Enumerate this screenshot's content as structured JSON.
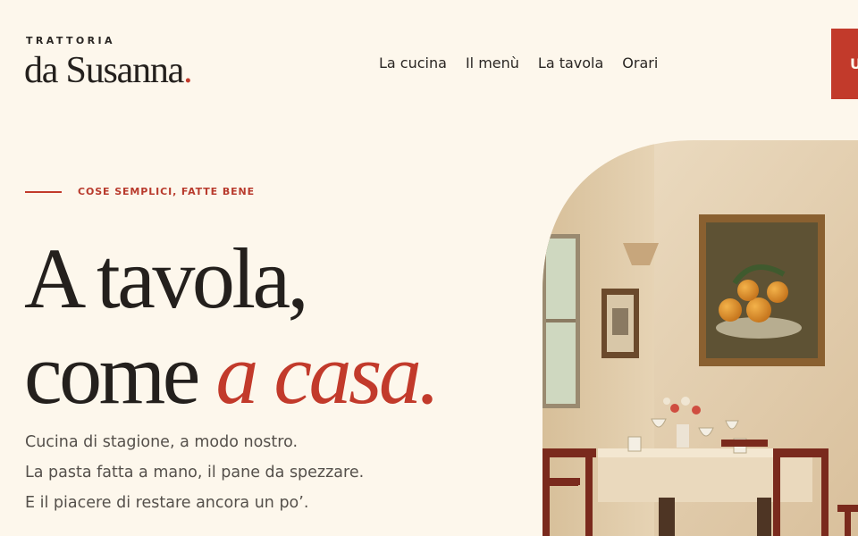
{
  "brand": {
    "eyebrow": "TRATTORIA",
    "name": "da Susanna",
    "dot": "."
  },
  "nav": {
    "items": [
      "La cucina",
      "Il menù",
      "La tavola",
      "Orari"
    ]
  },
  "cta": {
    "label": "U"
  },
  "hero": {
    "eyebrow": "COSE SEMPLICI, FATTE BENE",
    "headline_line1": "A tavola,",
    "headline_line2_plain": "come ",
    "headline_line2_accent": "a casa.",
    "body": [
      "Cucina di stagione, a modo nostro.",
      "La pasta fatta a mano, il pane da spezzare.",
      "E il piacere di restare ancora un po’."
    ]
  },
  "colors": {
    "background": "#fdf7ec",
    "accent": "#c23a2b",
    "text": "#24201d",
    "muted": "#55504b"
  }
}
